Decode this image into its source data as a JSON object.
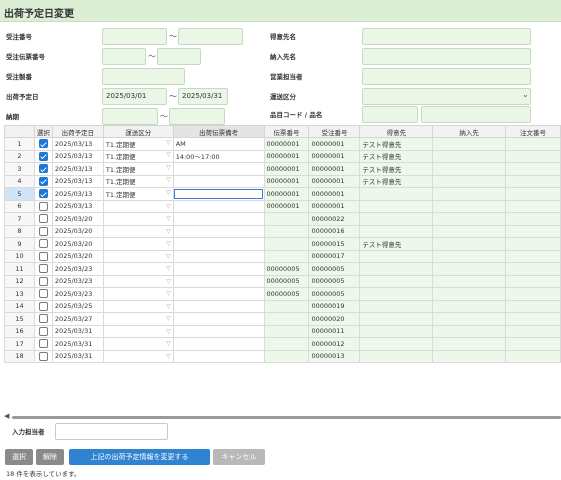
{
  "title": "出荷予定日変更",
  "form": {
    "left": [
      {
        "label": "受注番号",
        "from": "",
        "to": ""
      },
      {
        "label": "受注伝票番号",
        "from": "",
        "to": ""
      },
      {
        "label": "受注製番",
        "value": ""
      },
      {
        "label": "出荷予定日",
        "from": "2025/03/01",
        "to": "2025/03/31"
      },
      {
        "label": "納期",
        "from": "",
        "to": ""
      }
    ],
    "right": [
      {
        "label": "得意先名",
        "value": ""
      },
      {
        "label": "納入先名",
        "value": ""
      },
      {
        "label": "営業担当者",
        "value": ""
      },
      {
        "label": "運送区分",
        "value": ""
      },
      {
        "label": "品目コード / 品名",
        "code": "",
        "name": ""
      }
    ],
    "tilde": "～",
    "select_arrow": "chevron-down-icon"
  },
  "grid": {
    "columns": [
      "",
      "選択",
      "出荷予定日",
      "運送区分",
      "出荷伝票備考",
      "伝票番号",
      "受注番号",
      "得意先",
      "納入先",
      "注文番号"
    ],
    "dropdown_glyph": "▽",
    "rows": [
      {
        "no": "1",
        "checked": true,
        "date": "2025/03/13",
        "kubun": "T1.定期便",
        "biko": "AM",
        "denpyo": "00000001",
        "juchu": "00000001",
        "tokui": "テスト得意先",
        "nonyu": "",
        "chumon": ""
      },
      {
        "no": "2",
        "checked": true,
        "date": "2025/03/13",
        "kubun": "T1.定期便",
        "biko": "14:00～17:00",
        "denpyo": "00000001",
        "juchu": "00000001",
        "tokui": "テスト得意先",
        "nonyu": "",
        "chumon": ""
      },
      {
        "no": "3",
        "checked": true,
        "date": "2025/03/13",
        "kubun": "T1.定期便",
        "biko": "",
        "denpyo": "00000001",
        "juchu": "00000001",
        "tokui": "テスト得意先",
        "nonyu": "",
        "chumon": ""
      },
      {
        "no": "4",
        "checked": true,
        "date": "2025/03/13",
        "kubun": "T1.定期便",
        "biko": "",
        "denpyo": "00000001",
        "juchu": "00000001",
        "tokui": "テスト得意先",
        "nonyu": "",
        "chumon": ""
      },
      {
        "no": "5",
        "checked": true,
        "date": "2025/03/13",
        "kubun": "T1.定期便",
        "biko": "",
        "denpyo": "00000001",
        "juchu": "00000001",
        "tokui": "",
        "nonyu": "",
        "chumon": ""
      },
      {
        "no": "6",
        "checked": false,
        "date": "2025/03/13",
        "kubun": "",
        "biko": "",
        "denpyo": "00000001",
        "juchu": "00000001",
        "tokui": "",
        "nonyu": "",
        "chumon": ""
      },
      {
        "no": "7",
        "checked": false,
        "date": "2025/03/20",
        "kubun": "",
        "biko": "",
        "denpyo": "",
        "juchu": "00000022",
        "tokui": "",
        "nonyu": "",
        "chumon": ""
      },
      {
        "no": "8",
        "checked": false,
        "date": "2025/03/20",
        "kubun": "",
        "biko": "",
        "denpyo": "",
        "juchu": "00000016",
        "tokui": "",
        "nonyu": "",
        "chumon": ""
      },
      {
        "no": "9",
        "checked": false,
        "date": "2025/03/20",
        "kubun": "",
        "biko": "",
        "denpyo": "",
        "juchu": "00000015",
        "tokui": "テスト得意先",
        "nonyu": "",
        "chumon": ""
      },
      {
        "no": "10",
        "checked": false,
        "date": "2025/03/20",
        "kubun": "",
        "biko": "",
        "denpyo": "",
        "juchu": "00000017",
        "tokui": "",
        "nonyu": "",
        "chumon": ""
      },
      {
        "no": "11",
        "checked": false,
        "date": "2025/03/23",
        "kubun": "",
        "biko": "",
        "denpyo": "00000005",
        "juchu": "00000005",
        "tokui": "",
        "nonyu": "",
        "chumon": ""
      },
      {
        "no": "12",
        "checked": false,
        "date": "2025/03/23",
        "kubun": "",
        "biko": "",
        "denpyo": "00000005",
        "juchu": "00000005",
        "tokui": "",
        "nonyu": "",
        "chumon": ""
      },
      {
        "no": "13",
        "checked": false,
        "date": "2025/03/23",
        "kubun": "",
        "biko": "",
        "denpyo": "00000005",
        "juchu": "00000005",
        "tokui": "",
        "nonyu": "",
        "chumon": ""
      },
      {
        "no": "14",
        "checked": false,
        "date": "2025/03/25",
        "kubun": "",
        "biko": "",
        "denpyo": "",
        "juchu": "00000019",
        "tokui": "",
        "nonyu": "",
        "chumon": ""
      },
      {
        "no": "15",
        "checked": false,
        "date": "2025/03/27",
        "kubun": "",
        "biko": "",
        "denpyo": "",
        "juchu": "00000020",
        "tokui": "",
        "nonyu": "",
        "chumon": ""
      },
      {
        "no": "16",
        "checked": false,
        "date": "2025/03/31",
        "kubun": "",
        "biko": "",
        "denpyo": "",
        "juchu": "00000011",
        "tokui": "",
        "nonyu": "",
        "chumon": ""
      },
      {
        "no": "17",
        "checked": false,
        "date": "2025/03/31",
        "kubun": "",
        "biko": "",
        "denpyo": "",
        "juchu": "00000012",
        "tokui": "",
        "nonyu": "",
        "chumon": ""
      },
      {
        "no": "18",
        "checked": false,
        "date": "2025/03/31",
        "kubun": "",
        "biko": "",
        "denpyo": "",
        "juchu": "00000013",
        "tokui": "",
        "nonyu": "",
        "chumon": ""
      }
    ],
    "focused_row": 5
  },
  "footer": {
    "staff_label": "入力担当者",
    "staff_value": "",
    "buttons": {
      "select": "選択",
      "release": "解除",
      "change": "上記の出荷予定情報を変更する",
      "cancel": "キャンセル"
    },
    "status": "18 件を表示しています。"
  }
}
